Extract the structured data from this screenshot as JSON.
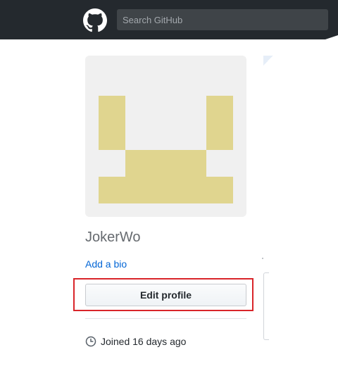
{
  "header": {
    "logo_icon": "github-octocat-icon",
    "search": {
      "placeholder": "Search GitHub",
      "value": ""
    }
  },
  "profile": {
    "avatar_colors": {
      "background": "#f0f0f0",
      "pixel": "#e0d58f"
    },
    "username": "JokerWo",
    "add_bio_label": "Add a bio",
    "edit_profile_label": "Edit profile",
    "joined_icon": "clock-icon",
    "joined_text": "Joined 16 days ago"
  },
  "colors": {
    "header_bg": "#24292e",
    "link": "#0366d6",
    "highlight": "#d9252a"
  }
}
